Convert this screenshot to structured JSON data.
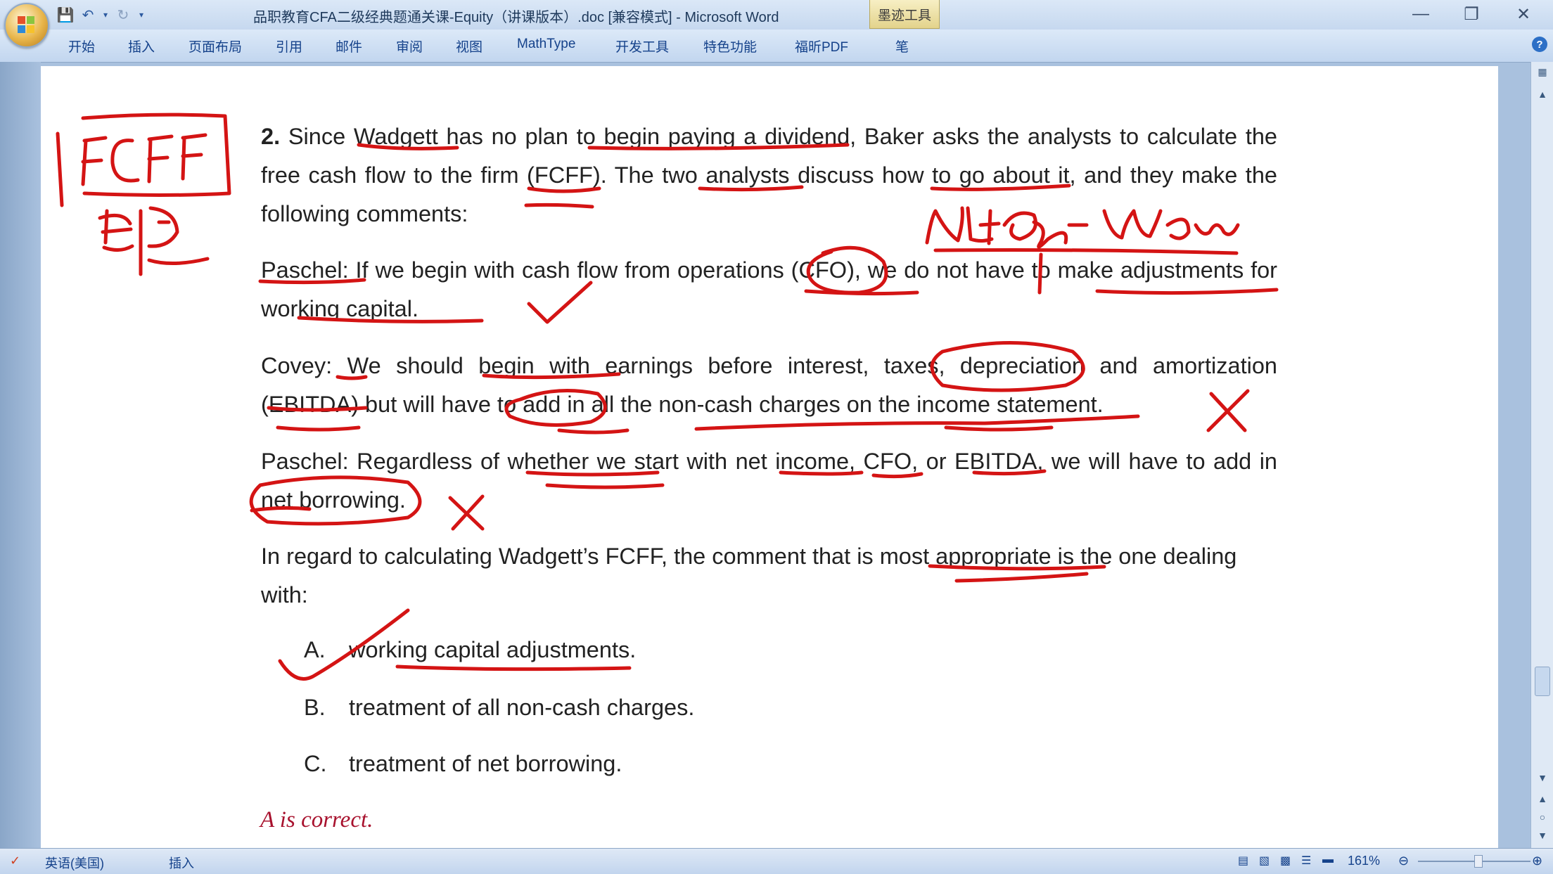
{
  "window": {
    "title": "品职教育CFA二级经典题通关课-Equity（讲课版本）.doc [兼容模式] - Microsoft Word",
    "context_tab": "墨迹工具",
    "controls": [
      "minimize",
      "restore",
      "close"
    ]
  },
  "ribbon": {
    "tabs": [
      "开始",
      "插入",
      "页面布局",
      "引用",
      "邮件",
      "审阅",
      "视图",
      "MathType",
      "开发工具",
      "特色功能",
      "福昕PDF",
      "笔"
    ]
  },
  "document": {
    "question_number": "2.",
    "question_text": "Since Wadgett has no plan to begin paying a dividend, Baker asks the analysts to calculate the free cash flow to the firm (FCFF). The two analysts discuss how to go about it, and they make the following comments:",
    "comments": [
      "Paschel: If we begin with cash flow from operations (CFO), we do not have to make adjustments for working capital.",
      "Covey: We should begin with earnings before interest, taxes, depreciation and amortization (EBITDA) but will have to add in all the non-cash charges on the income statement.",
      "Paschel: Regardless of whether we start with net income, CFO, or EBITDA, we will have to add in net borrowing."
    ],
    "prompt": "In regard to calculating Wadgett’s FCFF, the comment that is most appropriate is the one dealing with:",
    "options": [
      {
        "letter": "A.",
        "text": "working capital adjustments."
      },
      {
        "letter": "B.",
        "text": "treatment of all non-cash charges."
      },
      {
        "letter": "C.",
        "text": "treatment of net borrowing."
      }
    ],
    "answer": "A is correct."
  },
  "statusbar": {
    "language": "英语(美国)",
    "mode": "插入",
    "zoom": "161%"
  },
  "colors": {
    "ink": "#d41414",
    "answer": "#a8122e",
    "frame": "#c2d6ef"
  }
}
